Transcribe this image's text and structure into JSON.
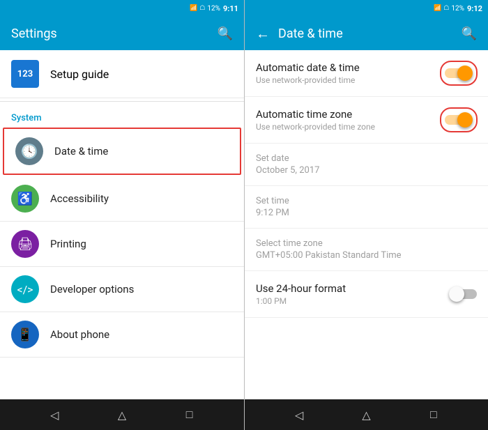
{
  "left": {
    "status_bar": {
      "time": "9:11",
      "battery": "12%"
    },
    "header": {
      "title": "Settings",
      "search_label": "Search"
    },
    "setup": {
      "label": "Setup guide",
      "icon_text": "123"
    },
    "system_section": "System",
    "items": [
      {
        "id": "date-time",
        "label": "Date & time",
        "icon": "clock",
        "icon_color": "grey",
        "highlighted": true
      },
      {
        "id": "accessibility",
        "label": "Accessibility",
        "icon": "person",
        "icon_color": "green"
      },
      {
        "id": "printing",
        "label": "Printing",
        "icon": "print",
        "icon_color": "purple"
      },
      {
        "id": "developer",
        "label": "Developer options",
        "icon": "code",
        "icon_color": "cyan"
      },
      {
        "id": "about",
        "label": "About phone",
        "icon": "phone",
        "icon_color": "phone-blue"
      }
    ]
  },
  "right": {
    "status_bar": {
      "time": "9:12",
      "battery": "12%"
    },
    "header": {
      "title": "Date & time",
      "back_label": "Back",
      "search_label": "Search"
    },
    "items": [
      {
        "id": "auto-date-time",
        "label": "Automatic date & time",
        "sub": "Use network-provided time",
        "toggle": true,
        "toggle_on": true
      },
      {
        "id": "auto-timezone",
        "label": "Automatic time zone",
        "sub": "Use network-provided time zone",
        "toggle": true,
        "toggle_on": true
      }
    ],
    "readonly": [
      {
        "id": "set-date",
        "label": "Set date",
        "value": "October 5, 2017"
      },
      {
        "id": "set-time",
        "label": "Set time",
        "value": "9:12 PM"
      },
      {
        "id": "timezone",
        "label": "Select time zone",
        "value": "GMT+05:00 Pakistan Standard Time"
      }
    ],
    "format24": {
      "label": "Use 24-hour format",
      "sub": "1:00 PM",
      "toggle_on": false
    }
  },
  "nav": {
    "back": "◁",
    "home": "△",
    "recent": "□"
  }
}
